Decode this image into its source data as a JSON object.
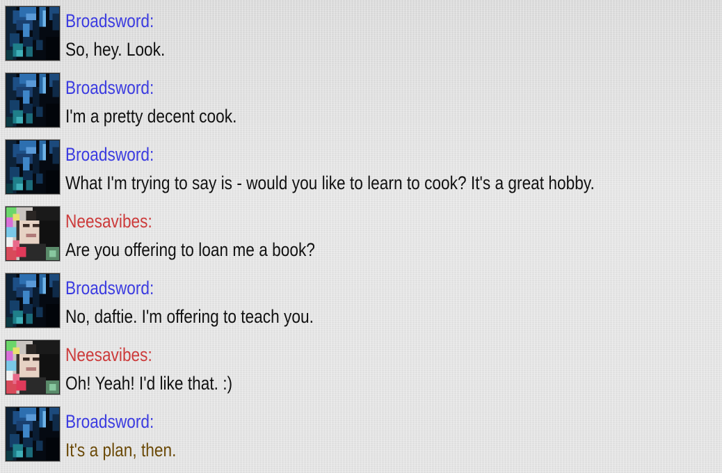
{
  "colors": {
    "broadsword": "#3b3be0",
    "neesavibes": "#cc3b3b",
    "text": "#111111",
    "highlight_text": "#6b4a08"
  },
  "messages": [
    {
      "speaker": "Broadsword:",
      "text": "So, hey. Look.",
      "avatar_icon": "broadsword-avatar-icon"
    },
    {
      "speaker": "Broadsword:",
      "text": "I'm a pretty decent cook.",
      "avatar_icon": "broadsword-avatar-icon"
    },
    {
      "speaker": "Broadsword:",
      "text": "What I'm trying to say is - would you like to learn to cook? It's a great hobby.",
      "avatar_icon": "broadsword-avatar-icon"
    },
    {
      "speaker": "Neesavibes:",
      "text": "Are you offering to loan me a book?",
      "avatar_icon": "neesavibes-avatar-icon"
    },
    {
      "speaker": "Broadsword:",
      "text": "No, daftie. I'm offering to teach you.",
      "avatar_icon": "broadsword-avatar-icon"
    },
    {
      "speaker": "Neesavibes:",
      "text": "Oh! Yeah! I'd like that. :)",
      "avatar_icon": "neesavibes-avatar-icon"
    },
    {
      "speaker": "Broadsword:",
      "text": "It's a plan, then.",
      "avatar_icon": "broadsword-avatar-icon"
    }
  ]
}
